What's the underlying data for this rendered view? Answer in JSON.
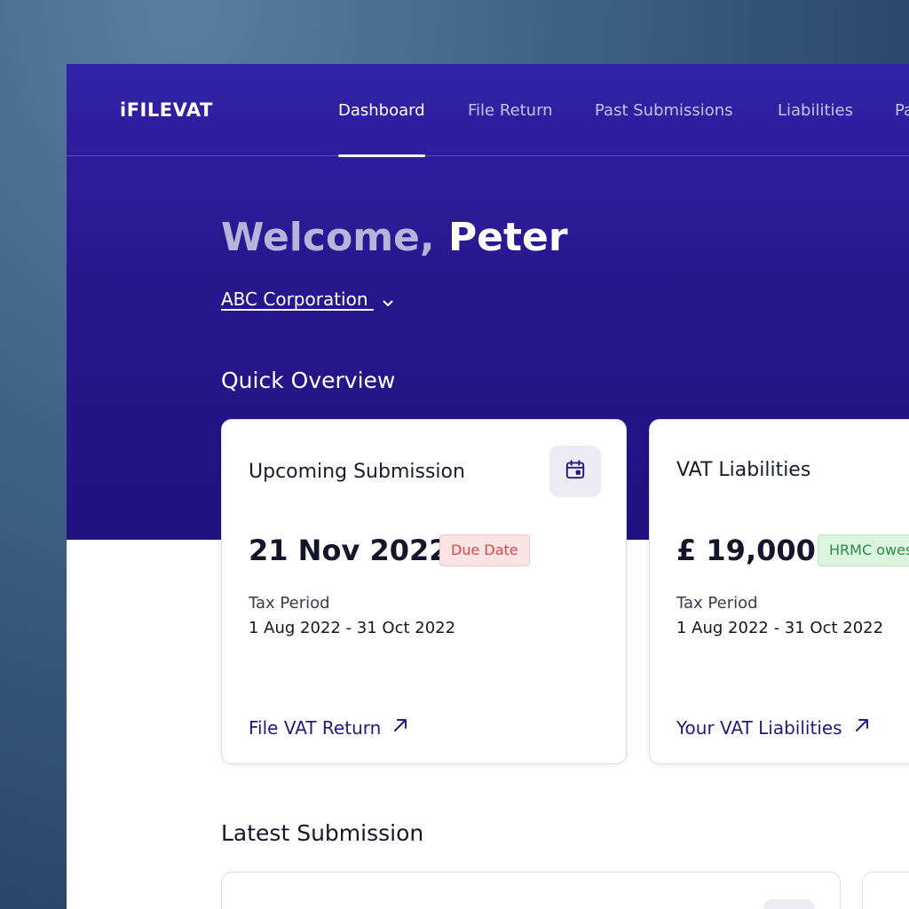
{
  "brand": {
    "logo": "iFILEVAT"
  },
  "nav": {
    "items": [
      {
        "label": "Dashboard",
        "active": true
      },
      {
        "label": "File Return",
        "active": false
      },
      {
        "label": "Past Submissions",
        "active": false
      },
      {
        "label": "Liabilities",
        "active": false
      },
      {
        "label": "Pa",
        "active": false
      }
    ]
  },
  "welcome": {
    "greeting": "Welcome,",
    "name": "Peter"
  },
  "company": {
    "name": "ABC Corporation"
  },
  "quick_overview": {
    "title": "Quick Overview",
    "cards": [
      {
        "title": "Upcoming Submission",
        "icon": "calendar-icon",
        "value": "21 Nov 2022",
        "badge": "Due Date",
        "period_label": "Tax Period",
        "period_value": "1 Aug 2022 - 31 Oct 2022",
        "link": "File VAT Return"
      },
      {
        "title": "VAT Liabilities",
        "value": "£ 19,000",
        "badge": "HRMC owes",
        "period_label": "Tax Period",
        "period_value": "1 Aug 2022 - 31 Oct 2022",
        "link": "Your VAT Liabilities"
      }
    ]
  },
  "latest_submission": {
    "title": "Latest Submission"
  },
  "colors": {
    "hero": "#27178f",
    "accent_link": "#241a7e",
    "badge_due": "#e04545",
    "badge_owes": "#2d8a47"
  }
}
